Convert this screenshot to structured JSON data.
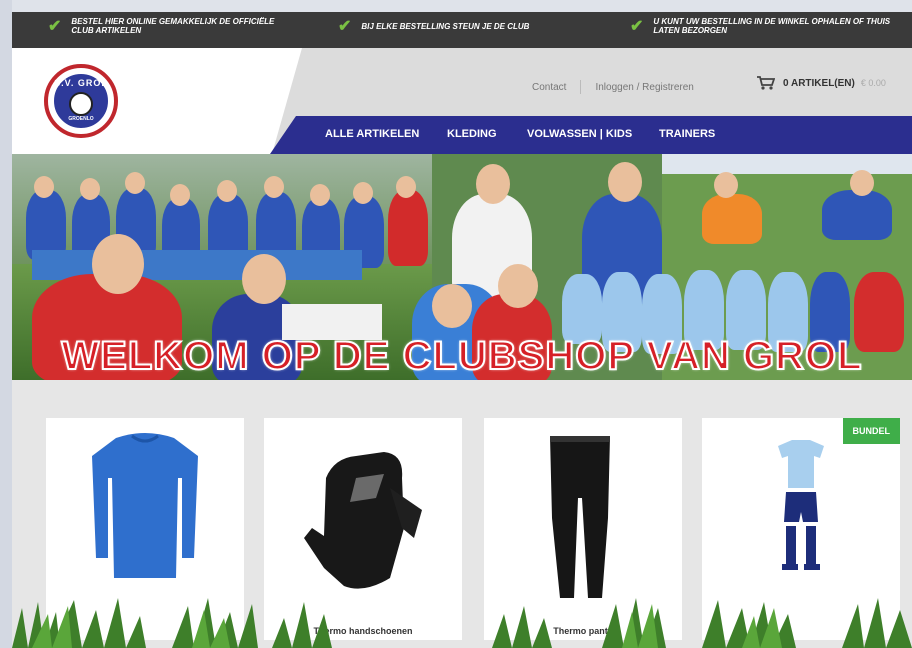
{
  "usp_bar": {
    "items": [
      "Bestel hier online gemakkelijk de officiële club artikelen",
      "Bij elke bestelling steun je de club",
      "U kunt uw bestelling in de winkel ophalen of thuis laten bezorgen"
    ],
    "icon": "check-icon",
    "icon_color": "#7ac143"
  },
  "header": {
    "logo": {
      "top_text": "S.V. GROL",
      "sub_text": "GROENLO"
    },
    "links": {
      "contact": "Contact",
      "login": "Inloggen / Registreren"
    },
    "cart": {
      "count_label": "0 ARTIKEL(EN)",
      "total": "€ 0.00",
      "icon": "cart-icon"
    }
  },
  "nav": {
    "items": [
      "ALLE ARTIKELEN",
      "KLEDING",
      "VOLWASSEN | KIDS",
      "TRAINERS"
    ],
    "color": "#2b2e8f"
  },
  "banner": {
    "title": "WELKOM OP DE CLUBSHOP VAN GROL",
    "title_color": "#d62027"
  },
  "products": [
    {
      "name": "",
      "image": "long-sleeve-shirt",
      "badge": ""
    },
    {
      "name": "Thermo handschoenen",
      "image": "gloves",
      "badge": ""
    },
    {
      "name": "Thermo pants",
      "image": "tights",
      "badge": ""
    },
    {
      "name": "",
      "image": "kit-bundle",
      "badge": "BUNDEL"
    }
  ],
  "colors": {
    "badge": "#3fae49",
    "dark_bar": "#3a3a3a"
  }
}
